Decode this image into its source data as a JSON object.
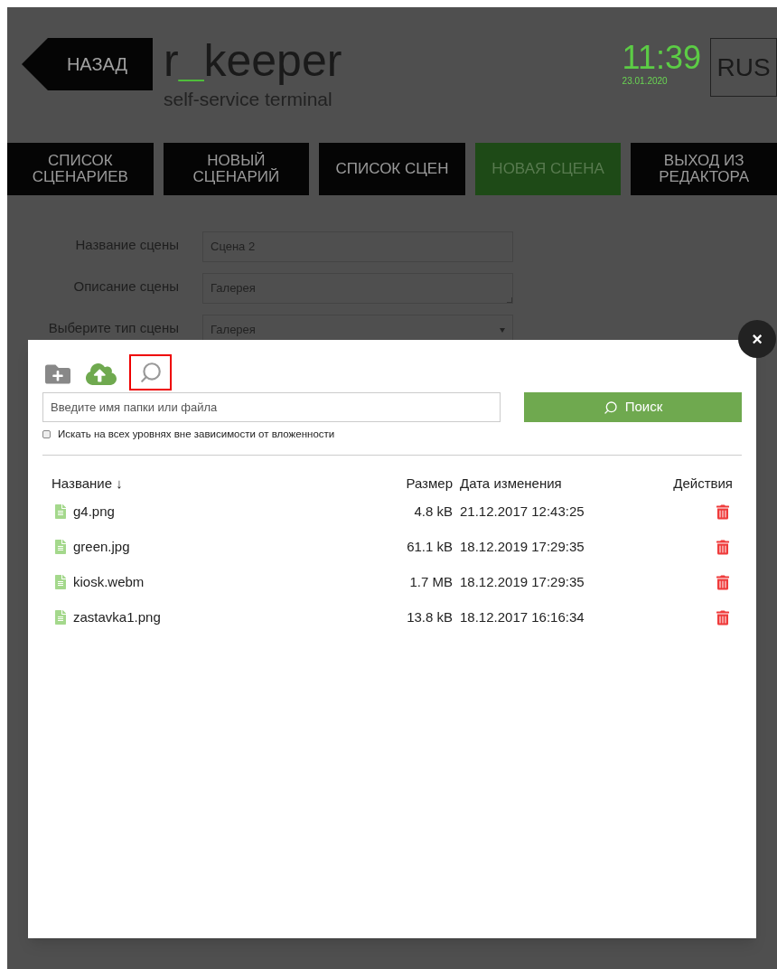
{
  "header": {
    "back_button": "НАЗАД",
    "logo": {
      "part1": "r",
      "part2": "_",
      "part3": "keeper"
    },
    "subtitle": "self-service terminal",
    "time": "11:39",
    "date": "23.01.2020",
    "language": "RUS"
  },
  "tabs": [
    {
      "label": "СПИСОК СЦЕНАРИЕВ",
      "selected": false
    },
    {
      "label": "НОВЫЙ СЦЕНАРИЙ",
      "selected": false
    },
    {
      "label": "СПИСОК СЦЕН",
      "selected": false
    },
    {
      "label": "НОВАЯ СЦЕНА",
      "selected": true
    },
    {
      "label": "ВЫХОД ИЗ РЕДАКТОРА",
      "selected": false
    }
  ],
  "form": [
    {
      "label": "Название сцены",
      "value": "Сцена 2",
      "kind": "input"
    },
    {
      "label": "Описание сцены",
      "value": "Галерея",
      "kind": "textarea"
    },
    {
      "label": "Выберите тип сцены",
      "value": "Галерея",
      "kind": "select"
    }
  ],
  "file_dialog": {
    "close": "×",
    "search": {
      "placeholder": "Введите имя папки или файла",
      "button": "Поиск",
      "recursive_label": "Искать на всех уровнях вне зависимости от вложенности",
      "recursive_checked": false
    },
    "columns": {
      "name": "Название ↓",
      "size": "Размер",
      "modified": "Дата изменения",
      "actions": "Действия"
    },
    "files": [
      {
        "name": "g4.png",
        "size": "4.8 kB",
        "modified": "21.12.2017 12:43:25"
      },
      {
        "name": "green.jpg",
        "size": "61.1 kB",
        "modified": "18.12.2019 17:29:35"
      },
      {
        "name": "kiosk.webm",
        "size": "1.7 MB",
        "modified": "18.12.2019 17:29:35"
      },
      {
        "name": "zastavka1.png",
        "size": "13.8 kB",
        "modified": "18.12.2017 16:16:34"
      }
    ]
  }
}
